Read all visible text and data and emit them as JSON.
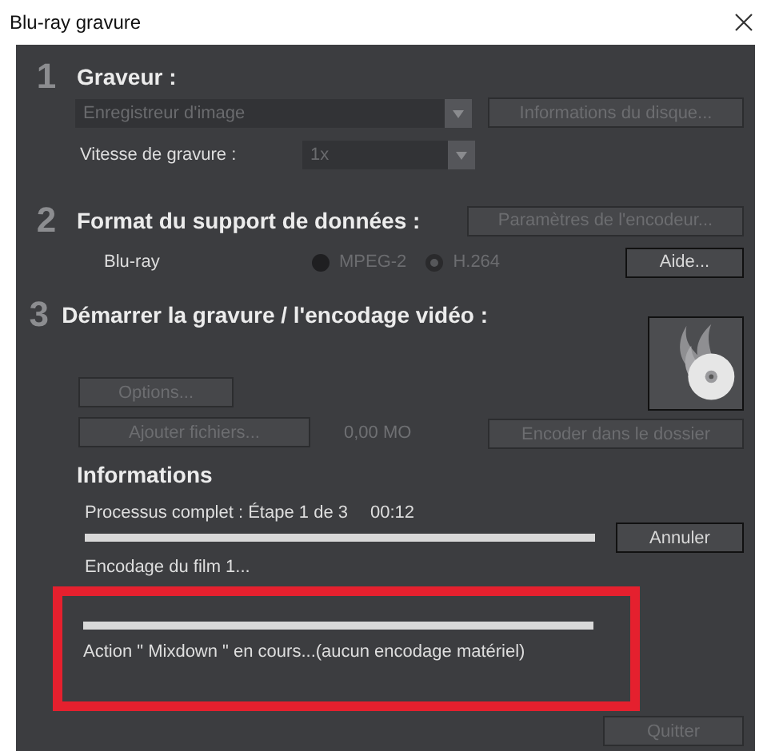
{
  "window": {
    "title": "Blu-ray gravure"
  },
  "recorder": {
    "number": "1",
    "heading": "Graveur :",
    "device": {
      "value": "Enregistreur d'image",
      "disabled": true
    },
    "disc_info_button": {
      "label": "Informations du disque...",
      "disabled": true
    },
    "speed_label": "Vitesse de gravure :",
    "speed": {
      "value": "1x",
      "disabled": true
    }
  },
  "format": {
    "number": "2",
    "heading": "Format du support de données :",
    "encoder_settings_button": {
      "label": "Paramètres de l'encodeur...",
      "disabled": true
    },
    "media": "Blu-ray",
    "codecs": [
      {
        "label": "MPEG-2",
        "selected": false
      },
      {
        "label": "H.264",
        "selected": true
      }
    ],
    "help_button": {
      "label": "Aide...",
      "disabled": false
    }
  },
  "start": {
    "number": "3",
    "heading": "Démarrer la gravure / l'encodage vidéo :",
    "options_button": {
      "label": "Options...",
      "disabled": true
    },
    "add_files_button": {
      "label": "Ajouter fichiers...",
      "disabled": true
    },
    "size": "0,00 MO",
    "encode_folder_button": {
      "label": "Encoder dans le dossier",
      "disabled": true
    }
  },
  "info": {
    "heading": "Informations",
    "process": "Processus complet : Étape 1 de 3",
    "time": "00:12",
    "overall": {
      "level": 1
    },
    "cancel_button": {
      "label": "Annuler",
      "disabled": false
    },
    "task": "Encodage du film 1...",
    "task_progress": {
      "level": 1
    },
    "status": "Action \" Mixdown \" en cours...(aucun encodage matériel)",
    "highlighted": true
  },
  "quit_button": {
    "label": "Quitter",
    "disabled": true
  }
}
